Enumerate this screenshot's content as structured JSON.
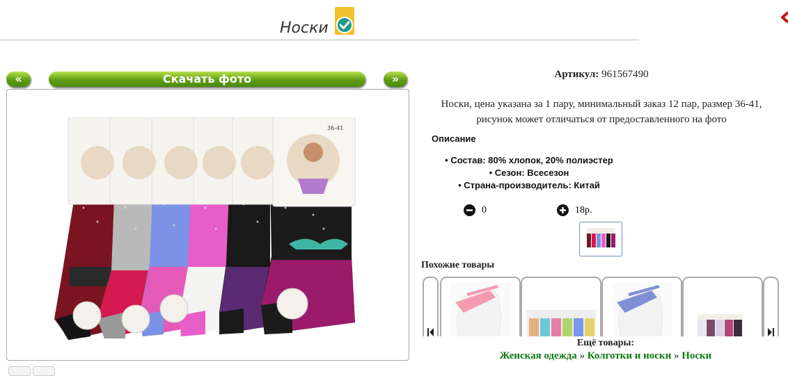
{
  "header": {
    "title": "Носки"
  },
  "gallery": {
    "prev_label": "«",
    "download_label": "Скачать фото",
    "next_label": "»"
  },
  "product": {
    "sku_label": "Артикул:",
    "sku_value": "961567490",
    "description_line1": "Носки, цена указана за 1 пару, минимальный заказ 12 пар, размер 36-41,",
    "description_line2": "рисунок может отличаться от предоставленного на фото",
    "description_title": "Описание",
    "attributes": [
      "Состав: 80% хлопок, 20% полиэстер",
      "Сезон: Всесезон",
      "Страна-производитель: Китай"
    ],
    "quantity": "0",
    "price": "18р.",
    "package_size_label": "36-41"
  },
  "similar": {
    "title": "Похожие товары"
  },
  "more": {
    "title": "Ещё товары:",
    "crumbs": [
      "Женская одежда",
      "Колготки и носки",
      "Носки"
    ],
    "separator": " » "
  },
  "colors": {
    "brand_green": "#5e9d12",
    "link_green": "#0c7a12",
    "badge_yellow": "#f2c12e",
    "badge_teal": "#1e9b8c"
  }
}
